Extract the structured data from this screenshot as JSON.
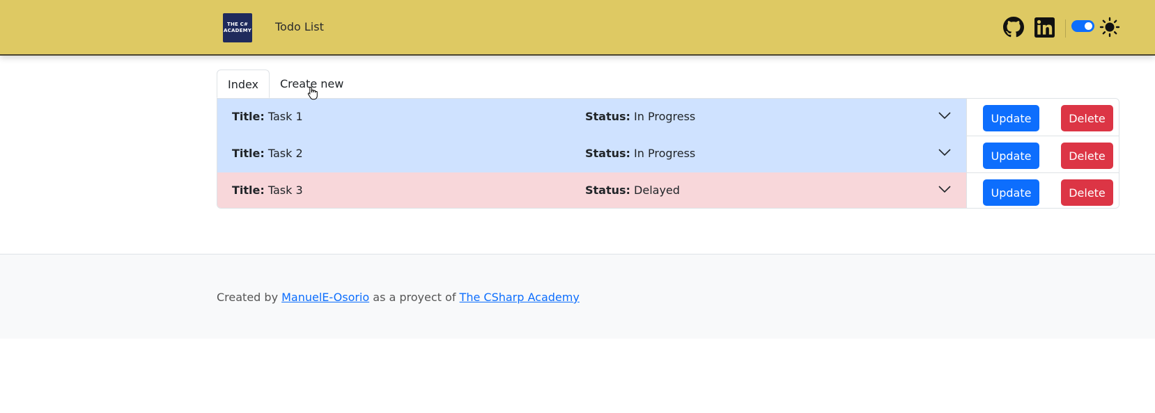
{
  "navbar": {
    "logo_line1": "THE C#",
    "logo_line2": "ACADEMY",
    "title": "Todo List",
    "icons": [
      "github-icon",
      "linkedin-icon",
      "theme-toggle",
      "sun-icon"
    ],
    "background_color": "#dec963"
  },
  "tabs": [
    {
      "label": "Index",
      "active": true
    },
    {
      "label": "Create new",
      "active": false
    }
  ],
  "tasks": [
    {
      "title_label": "Title:",
      "title": "Task 1",
      "status_label": "Status:",
      "status": "In Progress",
      "row_color": "#cfe2ff",
      "update_label": "Update",
      "delete_label": "Delete"
    },
    {
      "title_label": "Title:",
      "title": "Task 2",
      "status_label": "Status:",
      "status": "In Progress",
      "row_color": "#cfe2ff",
      "update_label": "Update",
      "delete_label": "Delete"
    },
    {
      "title_label": "Title:",
      "title": "Task 3",
      "status_label": "Status:",
      "status": "Delayed",
      "row_color": "#f8d7da",
      "update_label": "Update",
      "delete_label": "Delete"
    }
  ],
  "footer": {
    "prefix": "Created by",
    "author_link": "ManuelE-Osorio",
    "middle": "as a proyect of",
    "academy_link": "The CSharp Academy"
  },
  "colors": {
    "primary": "#0d6efd",
    "danger": "#dc3545",
    "in_progress": "#cfe2ff",
    "delayed": "#f8d7da"
  }
}
